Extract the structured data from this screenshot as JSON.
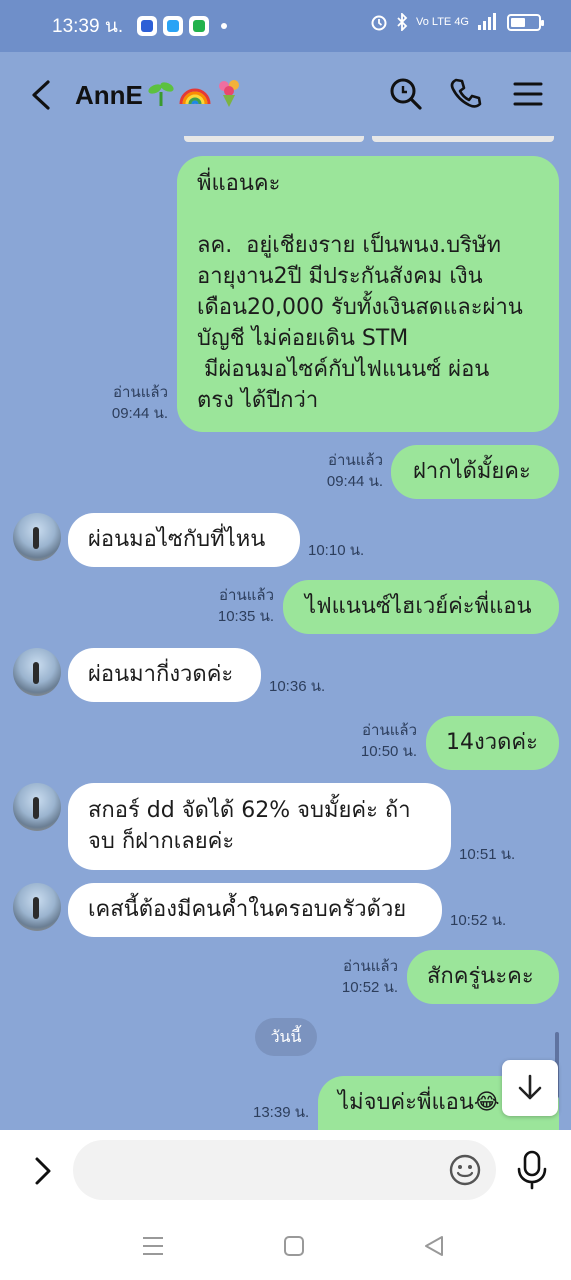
{
  "status_bar": {
    "time": "13:39 น.",
    "right_text": "Vo LTE 4G"
  },
  "header": {
    "title": "AnnE",
    "title_emojis": [
      "🌱",
      "🌈",
      "💐"
    ]
  },
  "messages": [
    {
      "side": "me",
      "text": "พี่แอนคะ\n\nลค.  อยู่เชียงราย เป็นพนง.บริษัท\nอายุงาน2ปี มีประกันสังคม เงิน\nเดือน20,000 รับทั้งเงินสดและผ่าน\nบัญชี ไม่ค่อยเดิน STM\n มีผ่อนมอไซค์กับไฟแนนซ์ ผ่อน\nตรง ได้ปีกว่า",
      "read": "อ่านแล้ว",
      "time": "09:44 น."
    },
    {
      "side": "me",
      "text": "ฝากได้มั้ยคะ",
      "read": "อ่านแล้ว",
      "time": "09:44 น."
    },
    {
      "side": "them",
      "text": "ผ่อนมอไซกับที่ไหน",
      "time": "10:10 น."
    },
    {
      "side": "me",
      "text": "ไฟแนนซ์ไฮเวย์ค่ะพี่แอน",
      "read": "อ่านแล้ว",
      "time": "10:35 น."
    },
    {
      "side": "them",
      "text": "ผ่อนมากี่งวดค่ะ",
      "time": "10:36 น."
    },
    {
      "side": "me",
      "text": "14งวดค่ะ",
      "read": "อ่านแล้ว",
      "time": "10:50 น."
    },
    {
      "side": "them",
      "text": "สกอร์ dd จัดได้ 62% จบมั้ยค่ะ ถ้า\nจบ ก็ฝากเลยค่ะ",
      "time": "10:51 น."
    },
    {
      "side": "them",
      "text": "เคสนี้ต้องมีคนค้ำในครอบครัวด้วย",
      "time": "10:52 น."
    },
    {
      "side": "me",
      "text": "สักครู่นะคะ",
      "read": "อ่านแล้ว",
      "time": "10:52 น."
    },
    {
      "side": "me",
      "text": "ไม่จบค่ะพี่แอน😂",
      "time": "13:39 น."
    }
  ],
  "date_divider": "วันนี้",
  "input": {
    "placeholder": ""
  },
  "colors": {
    "background": "#8aa6d6",
    "my_bubble": "#9be59a",
    "their_bubble": "#ffffff"
  }
}
